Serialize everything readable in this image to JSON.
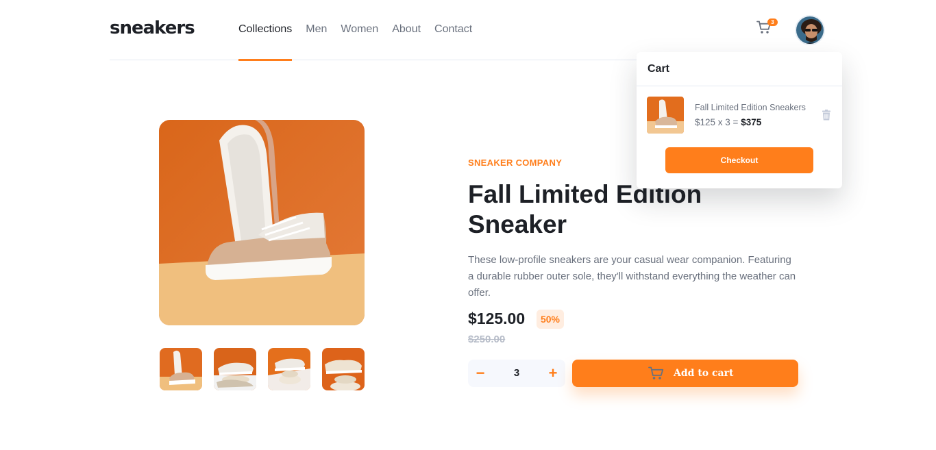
{
  "header": {
    "logo": "sneakers",
    "nav": [
      "Collections",
      "Men",
      "Women",
      "About",
      "Contact"
    ],
    "active_nav": "Collections",
    "cart_count": "3",
    "cart_icon": "cart-icon",
    "avatar_icon": "avatar"
  },
  "cart": {
    "title": "Cart",
    "item": {
      "name": "Fall Limited Edition Sneakers",
      "price_calc": "$125 x 3 = ",
      "total": "$375"
    },
    "delete_icon": "trash-icon",
    "checkout_label": "Checkout"
  },
  "product": {
    "company": "SNEAKER COMPANY",
    "title_line1": "Fall Limited Edition",
    "title_line2": "Sneaker",
    "description": "These low-profile sneakers are your casual wear companion. Featuring a durable rubber outer sole, they'll withstand everything the weather can offer.",
    "price": "$125.00",
    "discount": "50%",
    "old_price": "$250.00",
    "quantity": "3",
    "minus_label": "−",
    "plus_label": "+",
    "add_to_cart": "Add to cart"
  },
  "colors": {
    "accent": "#ff7e1b",
    "accent_light": "#ffede0",
    "text_dark": "#1d2026",
    "text_gray": "#69707d",
    "text_light": "#b6bcc8"
  }
}
